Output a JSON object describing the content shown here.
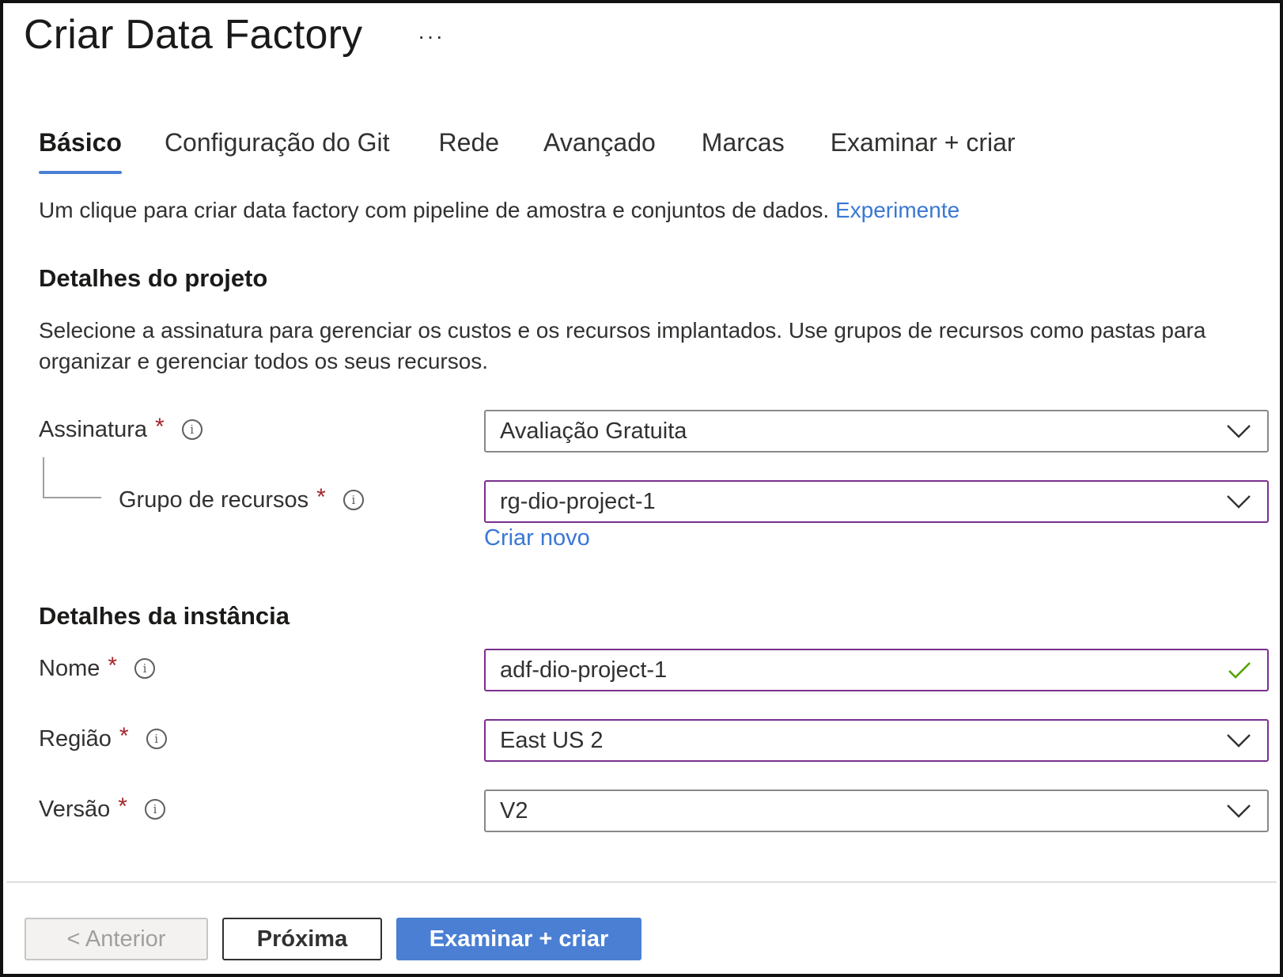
{
  "header": {
    "title": "Criar Data Factory",
    "more_label": "···"
  },
  "tabs": [
    {
      "label": "Básico",
      "active": true
    },
    {
      "label": "Configuração do Git",
      "active": false
    },
    {
      "label": "Rede",
      "active": false
    },
    {
      "label": "Avançado",
      "active": false
    },
    {
      "label": "Marcas",
      "active": false
    },
    {
      "label": "Examinar + criar",
      "active": false
    }
  ],
  "intro": {
    "text": "Um clique para criar data factory com pipeline de amostra e conjuntos de dados.",
    "link": "Experimente"
  },
  "project": {
    "title": "Detalhes do projeto",
    "description": "Selecione a assinatura para gerenciar os custos e os recursos implantados. Use grupos de recursos como pastas para organizar e gerenciar todos os seus recursos.",
    "subscription": {
      "label": "Assinatura",
      "required": "*",
      "value": "Avaliação Gratuita",
      "icon": "chevron-down-icon"
    },
    "resource_group": {
      "label": "Grupo de recursos",
      "required": "*",
      "value": "rg-dio-project-1",
      "icon": "chevron-down-icon",
      "create_new": "Criar novo"
    }
  },
  "instance": {
    "title": "Detalhes da instância",
    "name": {
      "label": "Nome",
      "required": "*",
      "value": "adf-dio-project-1",
      "icon": "check-icon",
      "valid_color": "#57a300"
    },
    "region": {
      "label": "Região",
      "required": "*",
      "value": "East US 2",
      "icon": "chevron-down-icon"
    },
    "version": {
      "label": "Versão",
      "required": "*",
      "value": "V2",
      "icon": "chevron-down-icon"
    }
  },
  "info_glyph": "i",
  "footer": {
    "prev_label": "< Anterior",
    "next_label": "Próxima",
    "review_label": "Examinar + criar"
  },
  "colors": {
    "accent": "#4a7fd4",
    "link": "#3a77d4",
    "required": "#a4262c",
    "focus_border": "#7b2f8f"
  }
}
